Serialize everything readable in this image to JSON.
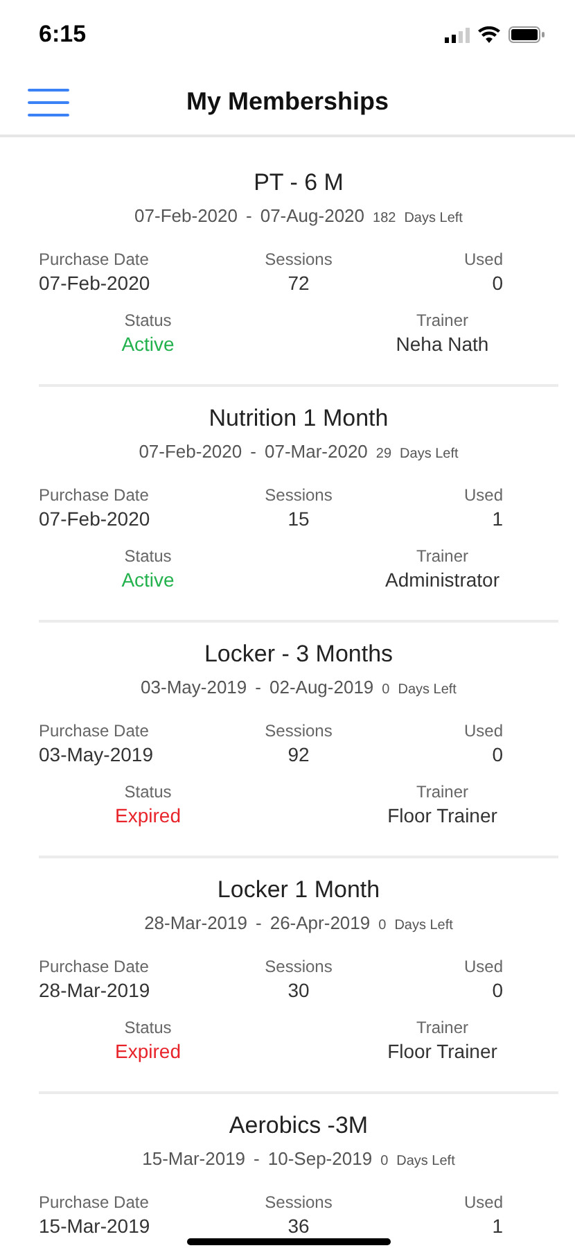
{
  "status_bar": {
    "time": "6:15"
  },
  "header": {
    "title": "My Memberships"
  },
  "memberships": [
    {
      "name": "PT - 6 M",
      "start": "07-Feb-2020",
      "dash": "-",
      "end": "07-Aug-2020",
      "days": "182",
      "days_label": "Days Left",
      "purchase_label": "Purchase Date",
      "purchase": "07-Feb-2020",
      "sessions_label": "Sessions",
      "sessions": "72",
      "used_label": "Used",
      "used": "0",
      "status_label": "Status",
      "status": "Active",
      "expired": false,
      "trainer_label": "Trainer",
      "trainer": "Neha Nath"
    },
    {
      "name": "Nutrition 1 Month",
      "start": "07-Feb-2020",
      "dash": "-",
      "end": "07-Mar-2020",
      "days": "29",
      "days_label": "Days Left",
      "purchase_label": "Purchase Date",
      "purchase": "07-Feb-2020",
      "sessions_label": "Sessions",
      "sessions": "15",
      "used_label": "Used",
      "used": "1",
      "status_label": "Status",
      "status": "Active",
      "expired": false,
      "trainer_label": "Trainer",
      "trainer": "Administrator"
    },
    {
      "name": "Locker - 3 Months",
      "start": "03-May-2019",
      "dash": "-",
      "end": "02-Aug-2019",
      "days": "0",
      "days_label": "Days Left",
      "purchase_label": "Purchase Date",
      "purchase": "03-May-2019",
      "sessions_label": "Sessions",
      "sessions": "92",
      "used_label": "Used",
      "used": "0",
      "status_label": "Status",
      "status": "Expired",
      "expired": true,
      "trainer_label": "Trainer",
      "trainer": "Floor Trainer"
    },
    {
      "name": "Locker 1 Month",
      "start": "28-Mar-2019",
      "dash": "-",
      "end": "26-Apr-2019",
      "days": "0",
      "days_label": "Days Left",
      "purchase_label": "Purchase Date",
      "purchase": "28-Mar-2019",
      "sessions_label": "Sessions",
      "sessions": "30",
      "used_label": "Used",
      "used": "0",
      "status_label": "Status",
      "status": "Expired",
      "expired": true,
      "trainer_label": "Trainer",
      "trainer": "Floor Trainer"
    },
    {
      "name": "Aerobics -3M",
      "start": "15-Mar-2019",
      "dash": "-",
      "end": "10-Sep-2019",
      "days": "0",
      "days_label": "Days Left",
      "purchase_label": "Purchase Date",
      "purchase": "15-Mar-2019",
      "sessions_label": "Sessions",
      "sessions": "36",
      "used_label": "Used",
      "used": "1"
    }
  ]
}
